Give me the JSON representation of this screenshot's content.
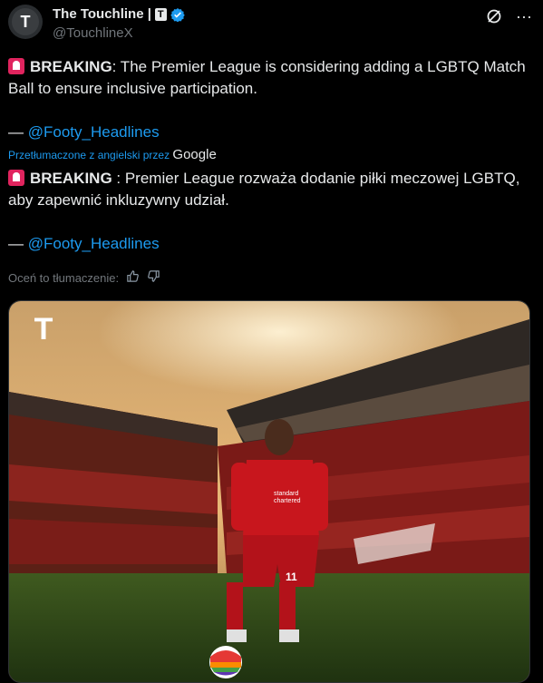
{
  "author": {
    "name": "The Touchline |",
    "name_badge": "T",
    "handle": "@TouchlineX",
    "avatar_letter": "T"
  },
  "actions": {
    "grok_icon": "slash-circle-icon",
    "more_icon": "more-icon",
    "more_glyph": "···"
  },
  "tweet": {
    "prefix": "BREAKING",
    "text": ": The Premier League is considering adding a LGBTQ Match Ball to ensure inclusive participation.",
    "credit_dash": "— ",
    "credit_link": "@Footy_Headlines"
  },
  "translation": {
    "label": "Przetłumaczone z angielski przez",
    "provider": "Google",
    "prefix": "BREAKING",
    "text": " : Premier League rozważa dodanie piłki meczowej LGBTQ, aby zapewnić inkluzywny udział.",
    "credit_dash": "— ",
    "credit_link": "@Footy_Headlines"
  },
  "rating": {
    "label": "Oceń to tłumaczenie:"
  },
  "media": {
    "logo": "T",
    "sponsor_line1": "standard",
    "sponsor_line2": "chartered",
    "shirt_number": "11"
  },
  "colors": {
    "link": "#1d9bf0",
    "siren": "#e0245e",
    "verified": "#1d9bf0"
  }
}
